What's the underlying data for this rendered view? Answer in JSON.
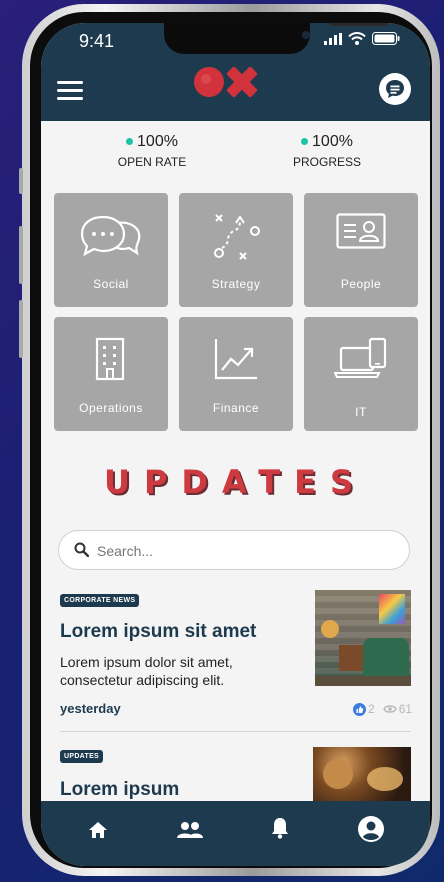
{
  "status_bar": {
    "time": "9:41"
  },
  "header": {
    "menu_icon": "hamburger-icon",
    "logo_icon": "ox-logo",
    "chat_icon": "chat-bubble-icon"
  },
  "stats": [
    {
      "value": "100%",
      "label": "OPEN RATE"
    },
    {
      "value": "100%",
      "label": "PROGRESS"
    }
  ],
  "categories": [
    {
      "label": "Social",
      "icon": "speech-bubbles-icon"
    },
    {
      "label": "Strategy",
      "icon": "strategy-path-icon"
    },
    {
      "label": "People",
      "icon": "id-card-icon"
    },
    {
      "label": "Operations",
      "icon": "building-icon"
    },
    {
      "label": "Finance",
      "icon": "line-chart-icon"
    },
    {
      "label": "IT",
      "icon": "devices-icon"
    }
  ],
  "updates": {
    "title": "UPDATES",
    "search_placeholder": "Search..."
  },
  "news": [
    {
      "badge": "CORPORATE NEWS",
      "title": "Lorem ipsum sit amet",
      "description": "Lorem ipsum dolor sit amet, consectetur adipiscing elit.",
      "date": "yesterday",
      "likes": "2",
      "views": "61"
    },
    {
      "badge": "UPDATES",
      "title": "Lorem ipsum"
    }
  ],
  "bottom_nav": [
    "home-icon",
    "people-icon",
    "bell-icon",
    "user-profile-icon"
  ],
  "colors": {
    "primary": "#1e3a4e",
    "accent": "#cd3b41",
    "status_dot": "#1bc4a4",
    "tile": "#a6a6a6"
  }
}
